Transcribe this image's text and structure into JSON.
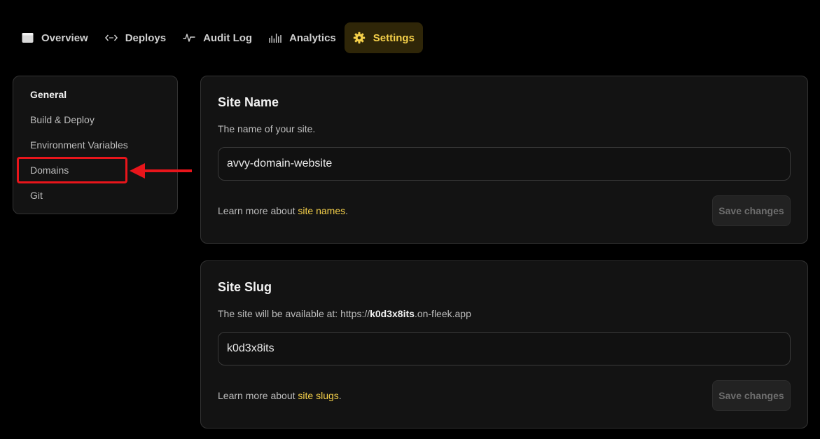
{
  "tabs": [
    {
      "label": "Overview",
      "icon": "window-icon",
      "active": false
    },
    {
      "label": "Deploys",
      "icon": "code-arrows-icon",
      "active": false
    },
    {
      "label": "Audit Log",
      "icon": "activity-pulse-icon",
      "active": false
    },
    {
      "label": "Analytics",
      "icon": "bar-chart-icon",
      "active": false
    },
    {
      "label": "Settings",
      "icon": "gear-icon",
      "active": true
    }
  ],
  "sidenav": {
    "items": [
      {
        "label": "General",
        "active": true
      },
      {
        "label": "Build & Deploy",
        "active": false
      },
      {
        "label": "Environment Variables",
        "active": false
      },
      {
        "label": "Domains",
        "active": false
      },
      {
        "label": "Git",
        "active": false
      }
    ]
  },
  "site_name": {
    "title": "Site Name",
    "description": "The name of your site.",
    "value": "avvy-domain-website",
    "learn_prefix": "Learn more about ",
    "learn_link": "site names",
    "learn_suffix": ".",
    "save_label": "Save changes"
  },
  "site_slug": {
    "title": "Site Slug",
    "description_prefix": "The site will be available at:  https://",
    "description_slug": "k0d3x8its",
    "description_suffix": ".on-fleek.app",
    "value": "k0d3x8its",
    "learn_prefix": "Learn more about ",
    "learn_link": "site slugs",
    "learn_suffix": ".",
    "save_label": "Save changes"
  },
  "colors": {
    "accent": "#f5d04a",
    "active_tab_bg": "#2f2608",
    "annotation": "#e8151b",
    "background": "#000000",
    "card": "#131313"
  }
}
